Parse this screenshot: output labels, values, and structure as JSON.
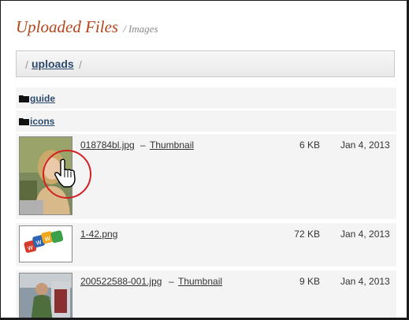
{
  "header": {
    "title": "Uploaded Files",
    "separator": "/",
    "subtitle": "Images"
  },
  "breadcrumb": {
    "leading_slash": "/",
    "current": "uploads",
    "trailing_slash": "/"
  },
  "folders": [
    {
      "name": "guide",
      "icon": "folder-icon"
    },
    {
      "name": "icons",
      "icon": "folder-icon"
    }
  ],
  "files": [
    {
      "name": "018784bl.jpg",
      "dash": "–",
      "thumbnail_label": "Thumbnail",
      "size": "6 KB",
      "date": "Jan 4, 2013"
    },
    {
      "name": "1-42.png",
      "dash": "",
      "thumbnail_label": "",
      "size": "72 KB",
      "date": "Jan 4, 2013"
    },
    {
      "name": "200522588-001.jpg",
      "dash": "–",
      "thumbnail_label": "Thumbnail",
      "size": "9 KB",
      "date": "Jan 4, 2013"
    }
  ],
  "cursor": {
    "icon": "hand-pointer-icon",
    "highlight_color": "#d42020"
  },
  "colors": {
    "title": "#b5451b",
    "link": "#2b4a6d",
    "row_bg": "#f4f4f4"
  }
}
